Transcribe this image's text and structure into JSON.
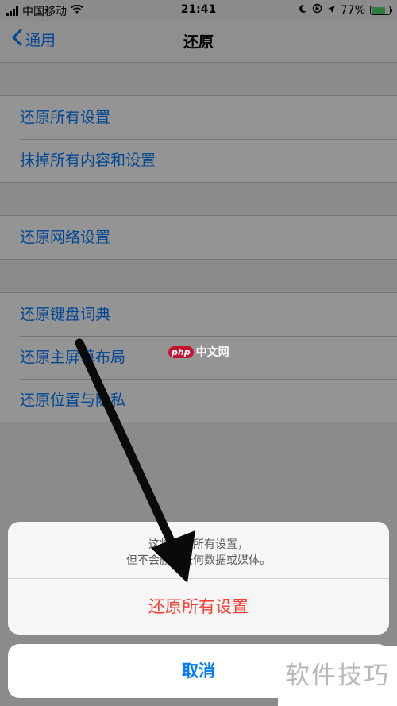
{
  "statusbar": {
    "carrier": "中国移动",
    "time": "21:41",
    "battery": "77%",
    "battery_level": 0.77,
    "icons": [
      "signal-icon",
      "wifi-icon",
      "moon-icon",
      "rotation-lock-icon",
      "location-icon",
      "battery-icon"
    ]
  },
  "navbar": {
    "back_label": "通用",
    "title": "还原"
  },
  "groups": [
    {
      "items": [
        {
          "label": "还原所有设置"
        },
        {
          "label": "抹掉所有内容和设置"
        }
      ]
    },
    {
      "items": [
        {
          "label": "还原网络设置"
        }
      ]
    },
    {
      "items": [
        {
          "label": "还原键盘词典"
        },
        {
          "label": "还原主屏幕布局"
        },
        {
          "label": "还原位置与隐私"
        }
      ]
    }
  ],
  "sheet": {
    "message_line1": "这将还原所有设置，",
    "message_line2": "但不会删除任何数据或媒体。",
    "action_label": "还原所有设置",
    "cancel_label": "取消"
  },
  "watermarks": {
    "php_badge": "php",
    "php_text": "中文网",
    "bottom_text": "软件技巧"
  },
  "colors": {
    "ios_blue": "#007aff",
    "destructive_red": "#ff3b30",
    "battery_green": "#4cd964"
  }
}
